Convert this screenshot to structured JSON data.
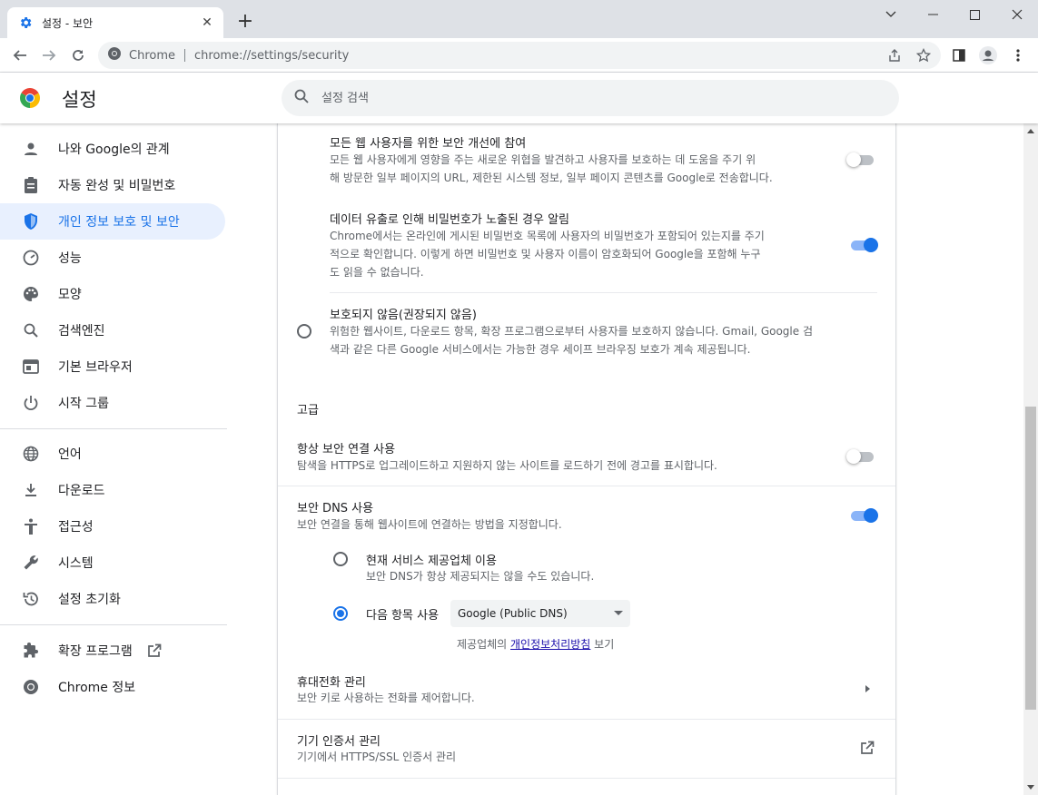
{
  "window": {
    "tab_title": "설정 - 보안",
    "new_tab": "+"
  },
  "toolbar": {
    "site_label": "Chrome",
    "url": "chrome://settings/security"
  },
  "header": {
    "title": "설정",
    "search_placeholder": "설정 검색"
  },
  "sidebar": {
    "items": [
      {
        "label": "나와 Google의 관계",
        "icon": "person-icon"
      },
      {
        "label": "자동 완성 및 비밀번호",
        "icon": "clipboard-icon"
      },
      {
        "label": "개인 정보 보호 및 보안",
        "icon": "shield-icon",
        "active": true
      },
      {
        "label": "성능",
        "icon": "speedometer-icon"
      },
      {
        "label": "모양",
        "icon": "palette-icon"
      },
      {
        "label": "검색엔진",
        "icon": "search-icon"
      },
      {
        "label": "기본 브라우저",
        "icon": "browser-icon"
      },
      {
        "label": "시작 그룹",
        "icon": "power-icon"
      },
      {
        "label": "언어",
        "icon": "globe-icon"
      },
      {
        "label": "다운로드",
        "icon": "download-icon"
      },
      {
        "label": "접근성",
        "icon": "accessibility-icon"
      },
      {
        "label": "시스템",
        "icon": "wrench-icon"
      },
      {
        "label": "설정 초기화",
        "icon": "reset-icon"
      },
      {
        "label": "확장 프로그램",
        "icon": "puzzle-icon"
      },
      {
        "label": "Chrome 정보",
        "icon": "chrome-icon"
      }
    ]
  },
  "main": {
    "improve_security": {
      "title": "모든 웹 사용자를 위한 보안 개선에 참여",
      "desc1": "모든 웹 사용자에게 영향을 주는 새로운 위협을 발견하고 사용자를 보호하는 데 도움을 주기 위",
      "desc2": "해 방문한 일부 페이지의 URL, 제한된 시스템 정보, 일부 페이지 콘텐츠를 Google로 전송합니다.",
      "enabled": false
    },
    "password_leak": {
      "title": "데이터 유출로 인해 비밀번호가 노출된 경우 알림",
      "desc1": "Chrome에서는 온라인에 게시된 비밀번호 목록에 사용자의 비밀번호가 포함되어 있는지를 주기",
      "desc2": "적으로 확인합니다. 이렇게 하면 비밀번호 및 사용자 이름이 암호화되어 Google을 포함해 누구",
      "desc3": "도 읽을 수 없습니다.",
      "enabled": true
    },
    "no_protection": {
      "title": "보호되지 않음(권장되지 않음)",
      "desc1": "위험한 웹사이트, 다운로드 항목, 확장 프로그램으로부터 사용자를 보호하지 않습니다. Gmail, Google 검",
      "desc2": "색과 같은 다른 Google 서비스에서는 가능한 경우 세이프 브라우징 보호가 계속 제공됩니다.",
      "selected": false
    },
    "advanced_heading": "고급",
    "https_always": {
      "title": "항상 보안 연결 사용",
      "desc": "탐색을 HTTPS로 업그레이드하고 지원하지 않는 사이트를 로드하기 전에 경고를 표시합니다.",
      "enabled": false
    },
    "secure_dns": {
      "title": "보안 DNS 사용",
      "desc": "보안 연결을 통해 웹사이트에 연결하는 방법을 지정합니다.",
      "enabled": true,
      "option_current": {
        "title": "현재 서비스 제공업체 이용",
        "desc": "보안 DNS가 항상 제공되지는 않을 수도 있습니다.",
        "selected": false
      },
      "option_custom": {
        "label": "다음 항목 사용",
        "selected": true,
        "provider": "Google (Public DNS)"
      },
      "privacy_prefix": "제공업체의 ",
      "privacy_link": "개인정보처리방침",
      "privacy_suffix": " 보기"
    },
    "phones": {
      "title": "휴대전화 관리",
      "desc": "보안 키로 사용하는 전화를 제어합니다."
    },
    "certificates": {
      "title": "기기 인증서 관리",
      "desc": "기기에서 HTTPS/SSL 인증서 관리"
    }
  },
  "colors": {
    "accent": "#1a73e8",
    "active_bg": "#e8f0fe",
    "tabstrip": "#dee1e6"
  }
}
